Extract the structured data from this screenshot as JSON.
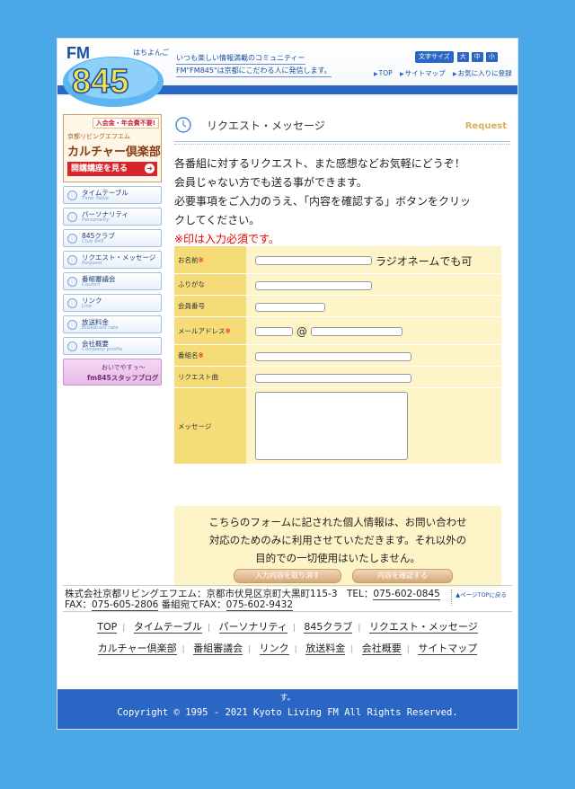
{
  "header": {
    "logo_fm": "FM",
    "logo_num": "845",
    "logo_kana": "はちよんご",
    "tagline1": "いつも楽しい情報満載のコミュニティー",
    "tagline2": "FM\"FM845\"は京都にこだわる人に発信します。",
    "fontsize_label": "文字サイズ",
    "fontsize_large": "大",
    "fontsize_medium": "中",
    "fontsize_small": "小",
    "links": [
      "TOP",
      "サイトマップ",
      "お気に入りに登録"
    ],
    "accent_color": "#2a66c4"
  },
  "sidebar": {
    "culture_banner": {
      "tag": "入会金・年会費不要!",
      "small": "京都リビングエフエム",
      "big": "カルチャー倶楽部",
      "button": "開講講座を見る"
    },
    "items": [
      {
        "jp": "タイムテーブル",
        "en": "Time Table"
      },
      {
        "jp": "パーソナリティ",
        "en": "Personality"
      },
      {
        "jp": "845クラブ",
        "en": "Club 845"
      },
      {
        "jp": "リクエスト・メッセージ",
        "en": "Request"
      },
      {
        "jp": "番組審議会",
        "en": "Council"
      },
      {
        "jp": "リンク",
        "en": "Link"
      },
      {
        "jp": "放送料金",
        "en": "Broadcast rate"
      },
      {
        "jp": "会社概要",
        "en": "Company profile"
      }
    ],
    "staff_blog": {
      "line1": "おいでやすぅ～",
      "line2": "fm845スタッフブログ"
    }
  },
  "main": {
    "title": "リクエスト・メッセージ",
    "title_en": "Request",
    "intro_lines": [
      "各番組に対するリクエスト、また感想などお気軽にどうぞ！",
      "会員じゃない方でも送る事ができます。",
      "必要事項をご入力のうえ、「内容を確認する」ボタンをクリッ",
      "クしてください。"
    ],
    "required_note": "※印は入力必須です。",
    "form": {
      "name_label": "お名前",
      "name_note": "ラジオネームでも可",
      "furigana_label": "ふりがな",
      "member_label": "会員番号",
      "email_label": "メールアドレス",
      "email_at": "@",
      "program_label": "番組名",
      "song_label": "リクエスト曲",
      "message_label": "メッセージ",
      "required_mark": "※"
    },
    "privacy_lines": [
      "こちらのフォームに記された個人情報は、お問い合わせ",
      "対応のためのみに利用させていただきます。それ以外の",
      "目的での一切使用はいたしません。"
    ],
    "reset_button": "入力内容を取り消す",
    "confirm_button": "内容を確認する"
  },
  "footer": {
    "address_prefix": "株式会社京都リビングエフエム：京都市伏見区京町大黒町115-3　TEL：",
    "tel": "075-602-0845",
    "fax_label": " FAX：",
    "fax": "075-605-2806",
    "program_fax_label": " 番組宛てFAX：",
    "program_fax": "075-602-9432",
    "page_top": "▲ページTOPに戻る",
    "links_row1": [
      "TOP",
      "タイムテーブル",
      "パーソナリティ",
      "845クラブ",
      "リクエスト・メッセージ"
    ],
    "links_row2": [
      "カルチャー倶楽部",
      "番組審議会",
      "リンク",
      "放送料金",
      "会社概要",
      "サイトマップ"
    ],
    "copyright_mark": "す。",
    "copyright": "Copyright © 1995 - 2021 Kyoto Living FM All Rights Reserved."
  }
}
